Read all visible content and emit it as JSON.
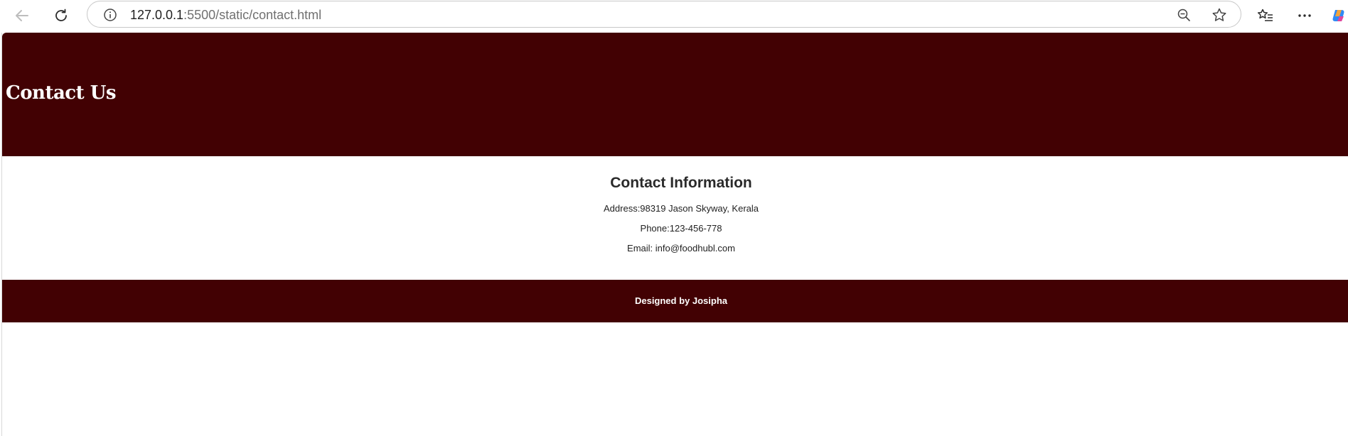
{
  "browser": {
    "url_host": "127.0.0.1",
    "url_path": ":5500/static/contact.html",
    "icons": {
      "back": "back-arrow-icon",
      "reload": "reload-icon",
      "site_info": "info-icon",
      "zoom": "zoom-out-icon",
      "favorite": "star-icon",
      "favorites": "favorites-list-icon",
      "more": "more-dots-icon",
      "copilot": "copilot-icon"
    }
  },
  "hero": {
    "title": "Contact Us",
    "background": "#420103"
  },
  "contact": {
    "heading": "Contact Information",
    "address": "Address:98319 Jason Skyway, Kerala",
    "phone": "Phone:123-456-778",
    "email": "Email: info@foodhubl.com"
  },
  "footer": {
    "credit": "Designed by Josipha",
    "background": "#420103"
  }
}
